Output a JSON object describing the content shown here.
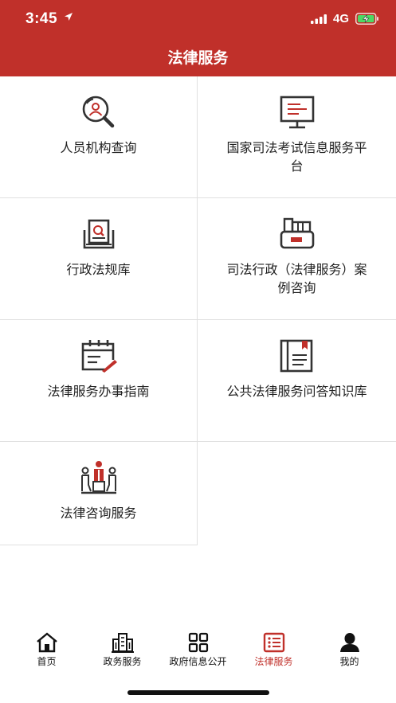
{
  "status_bar": {
    "time": "3:45",
    "network": "4G"
  },
  "header": {
    "title": "法律服务"
  },
  "services": [
    {
      "label": "人员机构查询",
      "icon": "magnifier-person-icon"
    },
    {
      "label": "国家司法考试信息服务平台",
      "icon": "monitor-icon"
    },
    {
      "label": "行政法规库",
      "icon": "document-search-icon"
    },
    {
      "label": "司法行政（法律服务）案例咨询",
      "icon": "file-folder-icon"
    },
    {
      "label": "法律服务办事指南",
      "icon": "calendar-pen-icon"
    },
    {
      "label": "公共法律服务问答知识库",
      "icon": "book-icon"
    },
    {
      "label": "法律咨询服务",
      "icon": "consultation-icon"
    }
  ],
  "tabbar": {
    "items": [
      {
        "label": "首页",
        "icon": "home-icon"
      },
      {
        "label": "政务服务",
        "icon": "building-icon"
      },
      {
        "label": "政府信息公开",
        "icon": "grid-icon"
      },
      {
        "label": "法律服务",
        "icon": "list-icon"
      },
      {
        "label": "我的",
        "icon": "user-icon"
      }
    ],
    "active": "法律服务"
  },
  "colors": {
    "brand": "#c0302a",
    "icon_dark": "#333333",
    "divider": "#e0e0e0"
  }
}
